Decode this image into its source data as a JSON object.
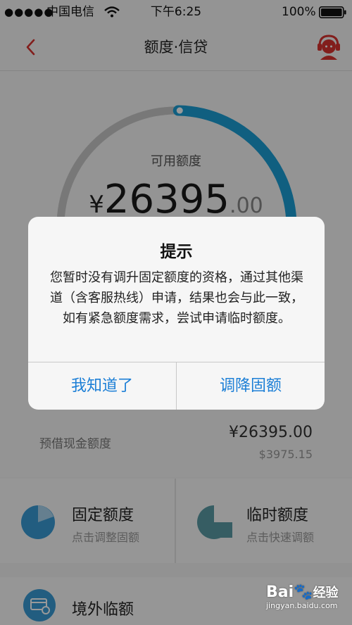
{
  "status_bar": {
    "signal": "●●●●●",
    "carrier": "中国电信",
    "time": "下午6:25",
    "battery_pct": "100%"
  },
  "nav": {
    "title": "额度·信贷"
  },
  "credit": {
    "label": "可用额度",
    "currency": "¥",
    "amount_int": "26395",
    "amount_dec": ".00",
    "progress_fraction": 0.28
  },
  "cash": {
    "label": "预借现金额度",
    "amount": "¥26395.00",
    "usd_amount": "$3975.15"
  },
  "cards": [
    {
      "title": "固定额度",
      "subtitle": "点击调整固额"
    },
    {
      "title": "临时额度",
      "subtitle": "点击快速调额"
    }
  ],
  "overseas": {
    "title": "境外临额"
  },
  "dialog": {
    "title": "提示",
    "message": "您暂时没有调升固定额度的资格，通过其他渠道（含客服热线）申请，结果也会与此一致，如有紧急额度需求，尝试申请临时额度。",
    "btn_left": "我知道了",
    "btn_right": "调降固额"
  },
  "watermark": {
    "brand": "Bai",
    "brand_suffix": "经验",
    "url": "jingyan.baidu.com"
  },
  "colors": {
    "accent_red": "#d9322f",
    "ring_blue": "#1b9fd6",
    "button_blue": "#1c7fd6"
  }
}
